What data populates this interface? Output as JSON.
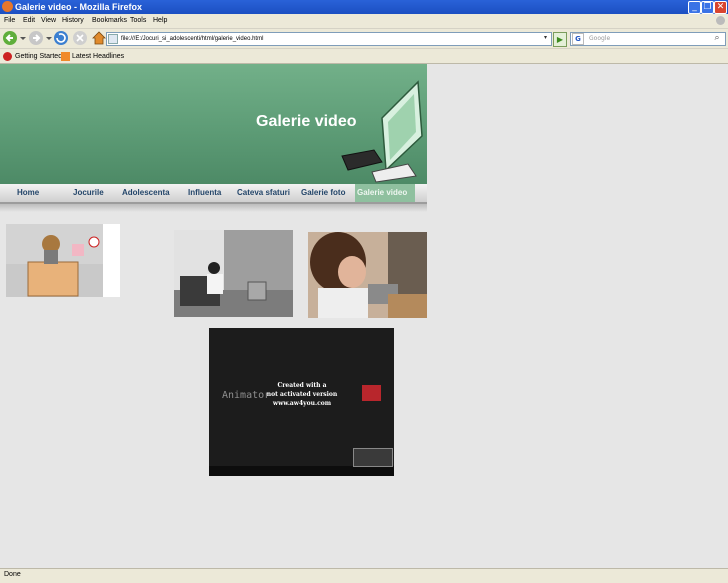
{
  "window": {
    "title": "Galerie video - Mozilla Firefox"
  },
  "menu": [
    "File",
    "Edit",
    "View",
    "History",
    "Bookmarks",
    "Tools",
    "Help"
  ],
  "toolbar": {
    "url": "file:///E:/Jocuri_si_adolescenti/html/galerie_video.html",
    "search_placeholder": "Google"
  },
  "bookmarks": [
    "Getting Started",
    "Latest Headlines"
  ],
  "page": {
    "banner_title": "Galerie video",
    "nav": [
      "Home",
      "Jocurile",
      "Adolescenta",
      "Influenta",
      "Cateva sfaturi",
      "Galerie foto",
      "Galerie video"
    ],
    "active_nav": "Galerie video",
    "video4_overlay": [
      "Created with a",
      "not activated version",
      "www.aw4you.com"
    ],
    "video4_brand": "Animator"
  },
  "status": "Done",
  "colors": {
    "banner_green": "#5d9c76",
    "nav_text": "#24466a",
    "active_tab": "#8fc09f"
  }
}
